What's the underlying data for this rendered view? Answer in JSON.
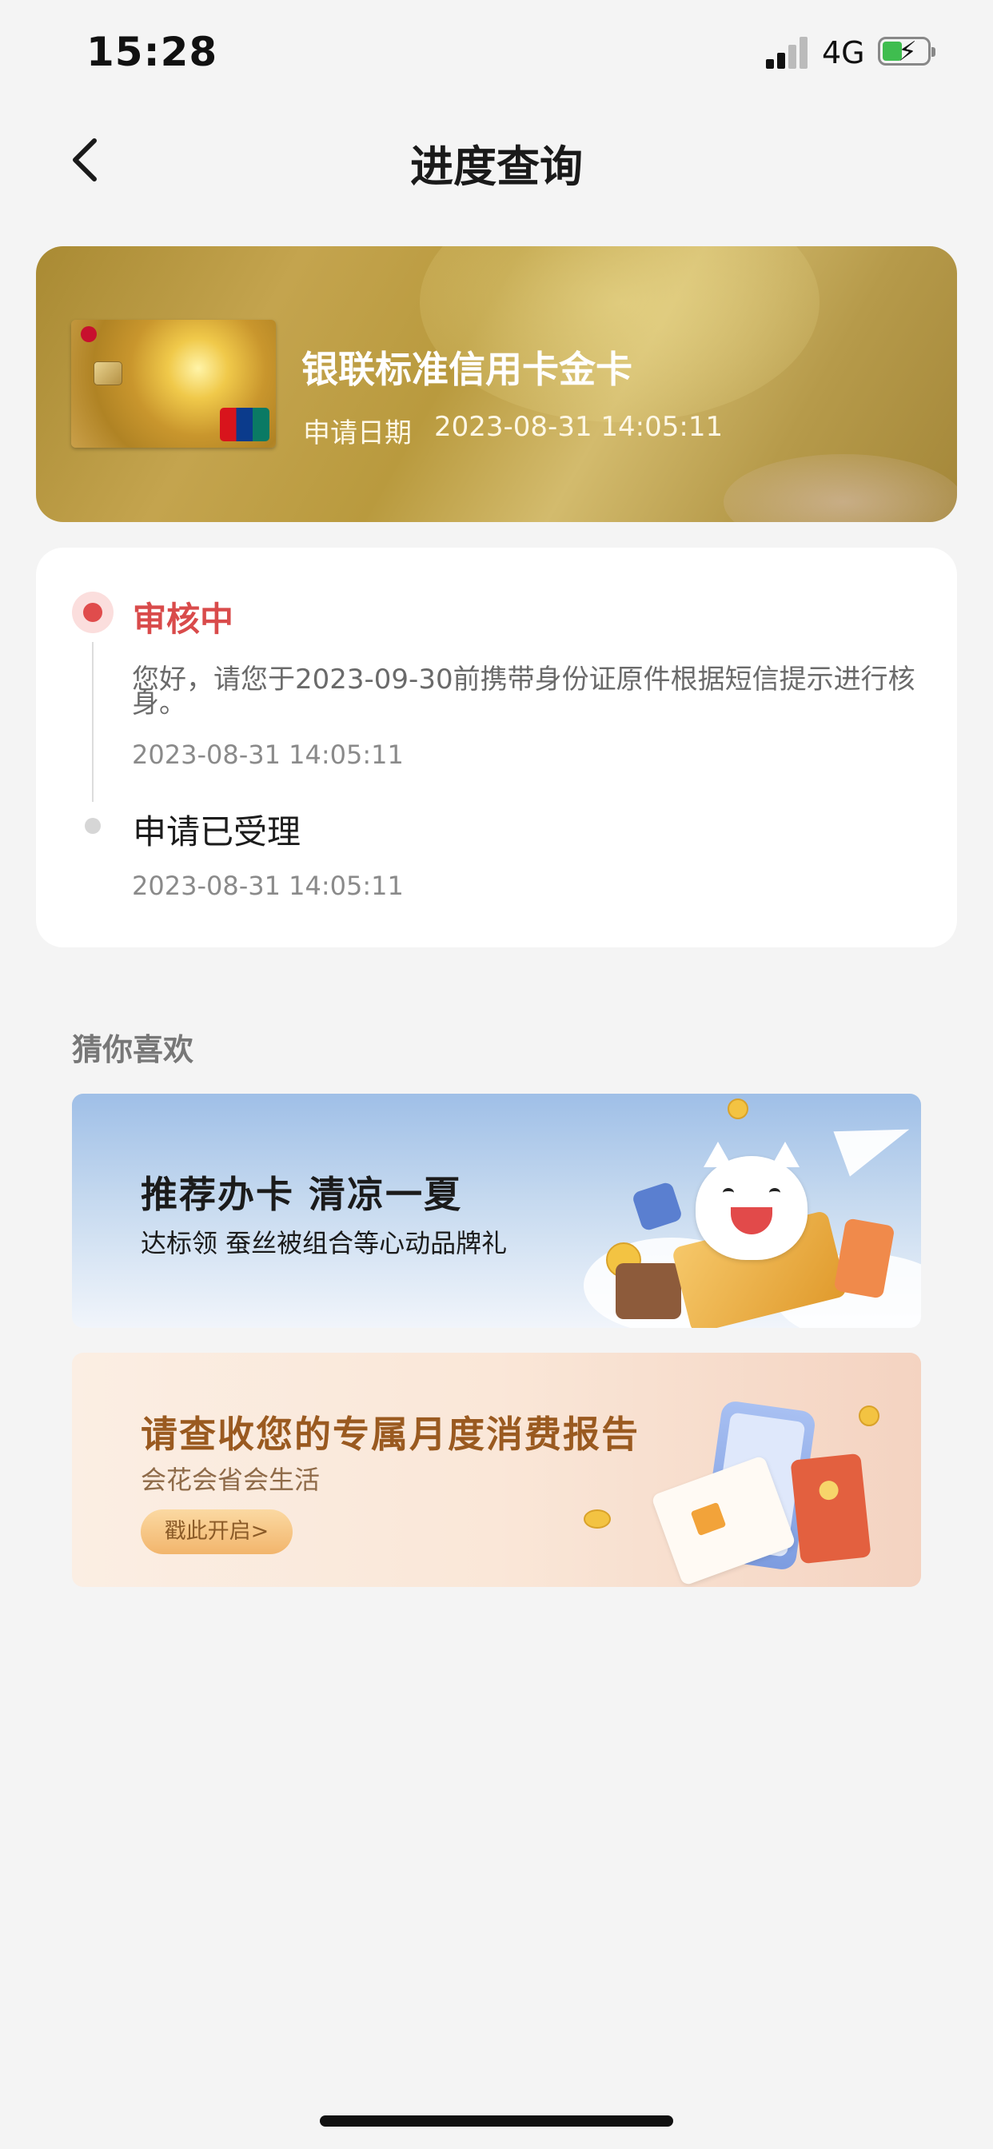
{
  "status_bar": {
    "time": "15:28",
    "network": "4G"
  },
  "nav": {
    "title": "进度查询"
  },
  "card": {
    "name": "银联标准信用卡金卡",
    "date_label": "申请日期",
    "date_value": "2023-08-31 14:05:11"
  },
  "progress": {
    "steps": [
      {
        "title": "审核中",
        "description": "您好，请您于2023-09-30前携带身份证原件根据短信提示进行核身。",
        "time": "2023-08-31 14:05:11",
        "status": "active",
        "color": "#d94b4b"
      },
      {
        "title": "申请已受理",
        "time": "2023-08-31 14:05:11",
        "status": "done"
      }
    ]
  },
  "recommendations": {
    "title": "猜你喜欢",
    "banners": [
      {
        "title": "推荐办卡 清凉一夏",
        "subtitle": "达标领 蚕丝被组合等心动品牌礼"
      },
      {
        "title": "请查收您的专属月度消费报告",
        "subtitle": "会花会省会生活",
        "button": "戳此开启>"
      }
    ]
  },
  "colors": {
    "accent": "#d94b4b",
    "card_gold": "#b99a3e",
    "background": "#f4f4f4"
  }
}
